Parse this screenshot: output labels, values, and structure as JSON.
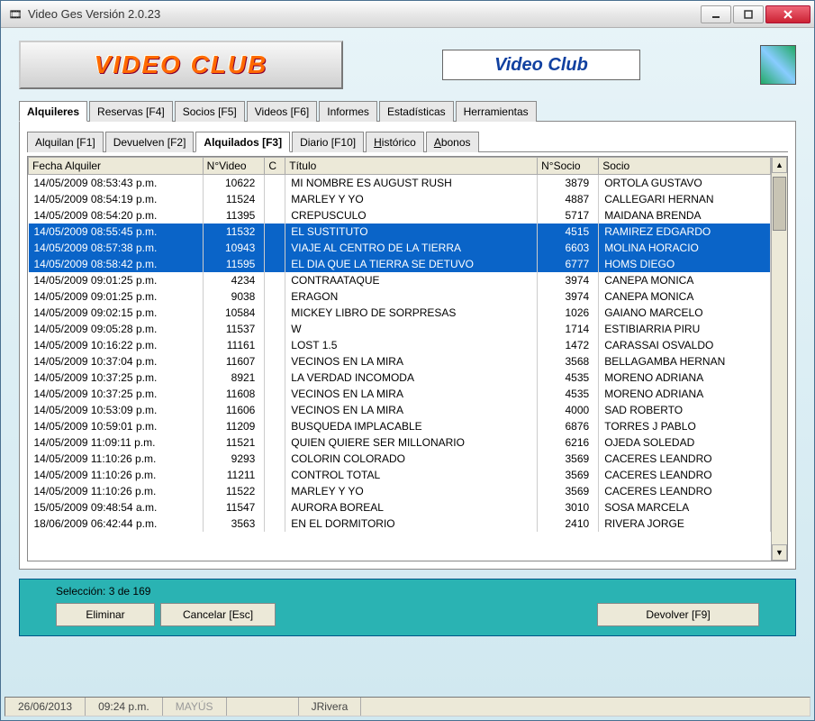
{
  "window": {
    "title": "Video Ges Versión 2.0.23"
  },
  "header": {
    "logo_text": "VIDEO CLUB",
    "label": "Video Club"
  },
  "mainTabs": [
    {
      "label": "Alquileres",
      "active": true
    },
    {
      "label": "Reservas [F4]"
    },
    {
      "label": "Socios [F5]"
    },
    {
      "label": "Videos [F6]"
    },
    {
      "label": "Informes"
    },
    {
      "label": "Estadísticas"
    },
    {
      "label": "Herramientas"
    }
  ],
  "subTabs": [
    {
      "label": "Alquilan [F1]"
    },
    {
      "label": "Devuelven [F2]"
    },
    {
      "label": "Alquilados [F3]",
      "active": true
    },
    {
      "label": "Diario [F10]"
    },
    {
      "label": "Histórico",
      "underline": 0
    },
    {
      "label": "Abonos",
      "underline": 0
    }
  ],
  "table": {
    "headers": [
      "Fecha Alquiler",
      "N°Video",
      "C",
      "Título",
      "N°Socio",
      "Socio"
    ],
    "rows": [
      {
        "fecha": "14/05/2009 08:53:43 p.m.",
        "nvideo": "10622",
        "c": "",
        "titulo": "MI NOMBRE ES AUGUST RUSH",
        "nsocio": "3879",
        "socio": "ORTOLA GUSTAVO"
      },
      {
        "fecha": "14/05/2009 08:54:19 p.m.",
        "nvideo": "11524",
        "c": "",
        "titulo": "MARLEY Y YO",
        "nsocio": "4887",
        "socio": "CALLEGARI HERNAN"
      },
      {
        "fecha": "14/05/2009 08:54:20 p.m.",
        "nvideo": "11395",
        "c": "",
        "titulo": "CREPUSCULO",
        "nsocio": "5717",
        "socio": "MAIDANA BRENDA"
      },
      {
        "fecha": "14/05/2009 08:55:45 p.m.",
        "nvideo": "11532",
        "c": "",
        "titulo": "EL SUSTITUTO",
        "nsocio": "4515",
        "socio": "RAMIREZ EDGARDO",
        "sel": true
      },
      {
        "fecha": "14/05/2009 08:57:38 p.m.",
        "nvideo": "10943",
        "c": "",
        "titulo": "VIAJE AL CENTRO DE LA TIERRA",
        "nsocio": "6603",
        "socio": "MOLINA HORACIO",
        "sel": true
      },
      {
        "fecha": "14/05/2009 08:58:42 p.m.",
        "nvideo": "11595",
        "c": "",
        "titulo": "EL DIA QUE LA TIERRA SE DETUVO",
        "nsocio": "6777",
        "socio": "HOMS DIEGO",
        "sel": true
      },
      {
        "fecha": "14/05/2009 09:01:25 p.m.",
        "nvideo": "4234",
        "c": "",
        "titulo": "CONTRAATAQUE",
        "nsocio": "3974",
        "socio": "CANEPA MONICA"
      },
      {
        "fecha": "14/05/2009 09:01:25 p.m.",
        "nvideo": "9038",
        "c": "",
        "titulo": "ERAGON",
        "nsocio": "3974",
        "socio": "CANEPA MONICA"
      },
      {
        "fecha": "14/05/2009 09:02:15 p.m.",
        "nvideo": "10584",
        "c": "",
        "titulo": "MICKEY LIBRO DE SORPRESAS",
        "nsocio": "1026",
        "socio": "GAIANO MARCELO"
      },
      {
        "fecha": "14/05/2009 09:05:28 p.m.",
        "nvideo": "11537",
        "c": "",
        "titulo": "W",
        "nsocio": "1714",
        "socio": "ESTIBIARRIA PIRU"
      },
      {
        "fecha": "14/05/2009 10:16:22 p.m.",
        "nvideo": "11161",
        "c": "",
        "titulo": "LOST 1.5",
        "nsocio": "1472",
        "socio": "CARASSAI OSVALDO"
      },
      {
        "fecha": "14/05/2009 10:37:04 p.m.",
        "nvideo": "11607",
        "c": "",
        "titulo": "VECINOS EN LA MIRA",
        "nsocio": "3568",
        "socio": "BELLAGAMBA HERNAN"
      },
      {
        "fecha": "14/05/2009 10:37:25 p.m.",
        "nvideo": "8921",
        "c": "",
        "titulo": "LA VERDAD INCOMODA",
        "nsocio": "4535",
        "socio": "MORENO ADRIANA"
      },
      {
        "fecha": "14/05/2009 10:37:25 p.m.",
        "nvideo": "11608",
        "c": "",
        "titulo": "VECINOS EN LA MIRA",
        "nsocio": "4535",
        "socio": "MORENO ADRIANA"
      },
      {
        "fecha": "14/05/2009 10:53:09 p.m.",
        "nvideo": "11606",
        "c": "",
        "titulo": "VECINOS EN LA MIRA",
        "nsocio": "4000",
        "socio": "SAD ROBERTO"
      },
      {
        "fecha": "14/05/2009 10:59:01 p.m.",
        "nvideo": "11209",
        "c": "",
        "titulo": "BUSQUEDA IMPLACABLE",
        "nsocio": "6876",
        "socio": "TORRES J PABLO"
      },
      {
        "fecha": "14/05/2009 11:09:11 p.m.",
        "nvideo": "11521",
        "c": "",
        "titulo": "QUIEN QUIERE SER MILLONARIO",
        "nsocio": "6216",
        "socio": "OJEDA SOLEDAD"
      },
      {
        "fecha": "14/05/2009 11:10:26 p.m.",
        "nvideo": "9293",
        "c": "",
        "titulo": "COLORIN COLORADO",
        "nsocio": "3569",
        "socio": "CACERES LEANDRO"
      },
      {
        "fecha": "14/05/2009 11:10:26 p.m.",
        "nvideo": "11211",
        "c": "",
        "titulo": "CONTROL TOTAL",
        "nsocio": "3569",
        "socio": "CACERES LEANDRO"
      },
      {
        "fecha": "14/05/2009 11:10:26 p.m.",
        "nvideo": "11522",
        "c": "",
        "titulo": "MARLEY Y YO",
        "nsocio": "3569",
        "socio": "CACERES LEANDRO"
      },
      {
        "fecha": "15/05/2009 09:48:54 a.m.",
        "nvideo": "11547",
        "c": "",
        "titulo": "AURORA BOREAL",
        "nsocio": "3010",
        "socio": "SOSA MARCELA"
      },
      {
        "fecha": "18/06/2009 06:42:44 p.m.",
        "nvideo": "3563",
        "c": "",
        "titulo": "EN EL DORMITORIO",
        "nsocio": "2410",
        "socio": "RIVERA JORGE"
      }
    ]
  },
  "footer": {
    "selection_label": "Selección: 3 de 169",
    "buttons": {
      "eliminar": "Eliminar",
      "cancelar": "Cancelar [Esc]",
      "devolver": "Devolver [F9]"
    }
  },
  "status": {
    "date": "26/06/2013",
    "time": "09:24 p.m.",
    "caps": "MAYÚS",
    "user": "JRivera"
  }
}
